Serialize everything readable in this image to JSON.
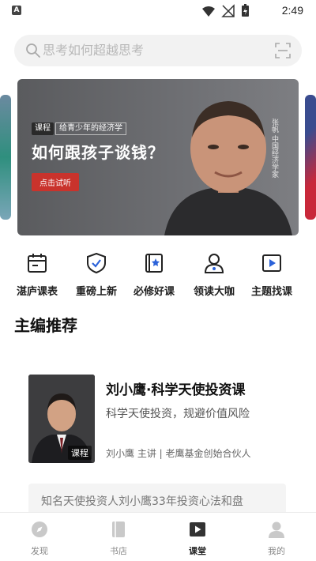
{
  "status_bar": {
    "time": "2:49",
    "app_icon_letter": "A",
    "icons": [
      "wifi-icon",
      "signal-icon",
      "battery-icon"
    ]
  },
  "search": {
    "placeholder": "思考如何超越思考",
    "icon": "search-icon",
    "scan_icon": "scan-icon"
  },
  "banner": {
    "tag": "课程",
    "subtitle": "给青少年的经济学",
    "headline": "如何跟孩子谈钱？",
    "cta": "点击试听",
    "vertical_text": "张帆 中国经济学家"
  },
  "quick_entries": [
    {
      "label": "湛庐课表",
      "icon": "calendar-icon"
    },
    {
      "label": "重磅上新",
      "icon": "shield-check-icon"
    },
    {
      "label": "必修好课",
      "icon": "star-book-icon"
    },
    {
      "label": "领读大咖",
      "icon": "person-icon"
    },
    {
      "label": "主题找课",
      "icon": "play-box-icon"
    }
  ],
  "section": {
    "title": "主编推荐"
  },
  "course": {
    "title": "刘小鹰·科学天使投资课",
    "description": "科学天使投资，规避价值风险",
    "meta": "刘小鹰 主讲 | 老鹰基金创始合伙人",
    "cover_tag": "课程",
    "quote": "知名天使投资人刘小鹰33年投资心法和盘"
  },
  "bottom_nav": [
    {
      "label": "发现",
      "icon": "compass-icon",
      "active": false
    },
    {
      "label": "书店",
      "icon": "book-icon",
      "active": false
    },
    {
      "label": "课堂",
      "icon": "play-icon",
      "active": true
    },
    {
      "label": "我的",
      "icon": "user-icon",
      "active": false
    }
  ],
  "colors": {
    "accent_red": "#c9332c",
    "text_primary": "#111111",
    "nav_active": "#222222",
    "nav_inactive": "#888888"
  }
}
